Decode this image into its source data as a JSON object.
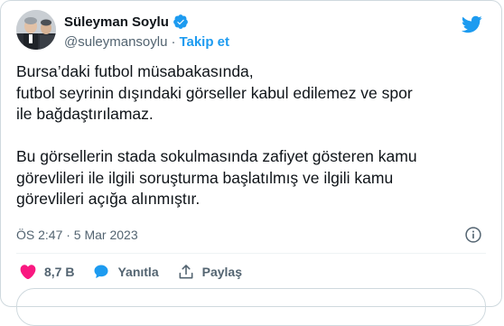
{
  "author": {
    "name": "Süleyman Soylu",
    "handle": "@suleymansoylu",
    "separator": "·",
    "follow_label": "Takip et",
    "verified_icon": "verified-badge-icon"
  },
  "tweet": {
    "paragraph1": [
      "Bursa’daki futbol müsabakasında,",
      "futbol seyrinin dışındaki görseller kabul edilemez ve spor",
      "ile bağdaştırılamaz."
    ],
    "paragraph2": [
      "Bu görsellerin stada sokulmasında zafiyet gösteren kamu",
      "görevlileri ile ilgili soruşturma başlatılmış ve ilgili kamu",
      "görevlileri açığa alınmıştır."
    ],
    "timestamp": "ÖS 2:47 · 5 Mar 2023"
  },
  "actions": {
    "likes": "8,7 B",
    "reply_label": "Yanıtla",
    "share_label": "Paylaş"
  },
  "colors": {
    "accent": "#1d9bf0",
    "like": "#f91880",
    "muted": "#536471"
  }
}
